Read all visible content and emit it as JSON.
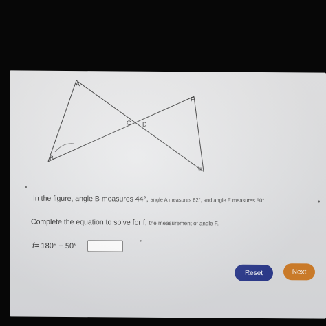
{
  "figure": {
    "labels": {
      "A": "A",
      "B": "B",
      "C": "C",
      "D": "D",
      "E": "E",
      "F": "F"
    }
  },
  "problem": {
    "statement_main": "In the figure, angle B measures 44°,",
    "statement_small": "angle A measures 62°, and angle E measures 50°."
  },
  "instruction": {
    "main": "Complete the equation to solve for f, the measurement of angle F.",
    "main_part1": "Complete the equation to solve for f,",
    "main_part2": "the measurement of angle F."
  },
  "equation": {
    "variable": "f",
    "text": "= 180° − 50° −",
    "answer_value": "",
    "unit": "°"
  },
  "buttons": {
    "reset_label": "Reset",
    "next_label": "Next"
  },
  "colors": {
    "reset": "#2e3c8f",
    "next": "#d4802b"
  }
}
